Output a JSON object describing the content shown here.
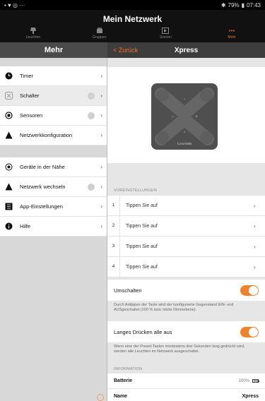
{
  "status": {
    "time": "07:43",
    "battery": "79%",
    "left_icons": "▪ ♥ ◎ ···"
  },
  "app": {
    "title": "Mein Netzwerk"
  },
  "nav_tabs": [
    {
      "label": "Leuchten",
      "icon": "lamp-icon",
      "active": false
    },
    {
      "label": "Gruppen",
      "icon": "group-icon",
      "active": false
    },
    {
      "label": "Szenen",
      "icon": "scene-icon",
      "active": false
    },
    {
      "label": "Mehr",
      "icon": "more-icon",
      "active": true
    }
  ],
  "left": {
    "header": "Mehr",
    "group1": [
      {
        "label": "Timer",
        "icon": "clock-icon",
        "badge": false
      },
      {
        "label": "Schalter",
        "icon": "switch-icon",
        "badge": true,
        "selected": true
      },
      {
        "label": "Sensoren",
        "icon": "sensor-icon",
        "badge": true
      },
      {
        "label": "Netzwerkkonfiguration",
        "icon": "network-icon",
        "badge": false
      }
    ],
    "group2": [
      {
        "label": "Geräte in der Nähe",
        "icon": "nearby-icon",
        "badge": false
      },
      {
        "label": "Netzwerk wechseln",
        "icon": "network-switch-icon",
        "badge": true
      },
      {
        "label": "App-Einstellungen",
        "icon": "settings-icon",
        "badge": false
      },
      {
        "label": "Hilfe",
        "icon": "info-icon",
        "badge": false
      }
    ]
  },
  "right": {
    "back_label": "Zurück",
    "title": "Xpress",
    "device_brand": "CASAMBI",
    "presets_section": "VOREINSTELLUNGEN",
    "presets": [
      {
        "num": "1",
        "label": "Tippen Sie auf"
      },
      {
        "num": "2",
        "label": "Tippen Sie auf"
      },
      {
        "num": "3",
        "label": "Tippen Sie auf"
      },
      {
        "num": "4",
        "label": "Tippen Sie auf"
      }
    ],
    "toggle1": {
      "label": "Umschalten",
      "on": true,
      "desc": "Durch Antippen der Taste wird der konfigurierte Gegenstand EIN- und AUSgeschaltet (100 % bzw. letzte Dimmebene)."
    },
    "toggle2": {
      "label": "Langes Drücken alle aus",
      "on": true,
      "desc": "Wenn eine der Preset-Tasten mindestens drei Sekunden lang gedrückt wird, werden alle Leuchten im Netzwerk ausgeschaltet."
    },
    "info_section": "INFORMATION",
    "battery": {
      "label": "Batterie",
      "value": "100%",
      "level": 1.0
    },
    "name": {
      "label": "Name",
      "value": "Xpress"
    }
  },
  "colors": {
    "accent": "#f37021",
    "toggle": "#f0822c"
  }
}
